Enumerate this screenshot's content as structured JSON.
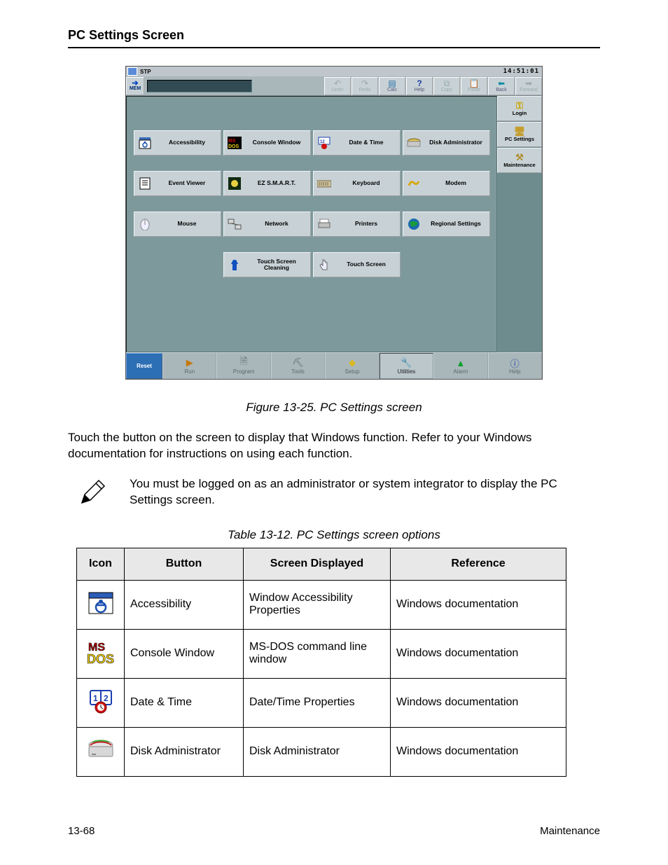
{
  "doc": {
    "heading": "PC Settings Screen",
    "fig_caption": "Figure 13-25. PC Settings screen",
    "para": "Touch the button on the screen to display that Windows function. Refer to your Windows documentation for instructions on using each function.",
    "note_text": "You must be logged on as an administrator or system integrator to display the PC Settings screen.",
    "table_title": "Table 13-12. PC Settings screen options",
    "th_icon": "Icon",
    "th_button": "Button",
    "th_screen": "Screen Displayed",
    "th_ref": "Reference",
    "footer_page": "13-68",
    "footer_text": "Maintenance"
  },
  "table_rows": [
    {
      "button": "Accessibility",
      "screen": "Window Accessibility Properties",
      "ref": "Windows documentation"
    },
    {
      "button": "Console Window",
      "screen": "MS-DOS command line window",
      "ref": "Windows documentation"
    },
    {
      "button": "Date & Time",
      "screen": "Date/Time Properties",
      "ref": "Windows documentation"
    },
    {
      "button": "Disk Administrator",
      "screen": "Disk Administrator",
      "ref": "Windows documentation"
    }
  ],
  "screenshot": {
    "title_label": "STP",
    "clock": "14:51:01",
    "mem_label": "MEM",
    "toolbar": {
      "undo": "Undo",
      "redo": "Redo",
      "calc": "Calc",
      "help": "Help",
      "copy": "Copy",
      "paste": "Paste",
      "back": "Back",
      "forward": "Forward"
    },
    "side": {
      "login": "Login",
      "pc": "PC Settings",
      "maint": "Maintenance"
    },
    "apps": [
      "Accessibility",
      "Console Window",
      "Date & Time",
      "Disk Administrator",
      "Event Viewer",
      "EZ S.M.A.R.T.",
      "Keyboard",
      "Modem",
      "Mouse",
      "Network",
      "Printers",
      "Regional Settings",
      "",
      "Touch Screen Cleaning",
      "Touch Screen",
      ""
    ],
    "taskbar": {
      "reset": "Reset",
      "run": "Run",
      "program": "Program",
      "tools": "Tools",
      "setup": "Setup",
      "utilities": "Utilities",
      "alarm": "Alarm",
      "help": "Help"
    }
  }
}
